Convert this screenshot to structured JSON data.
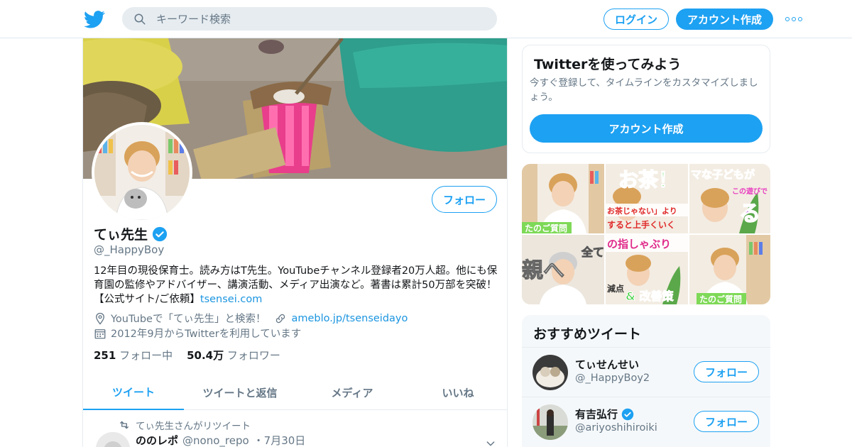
{
  "header": {
    "search_placeholder": "キーワード検索",
    "login_label": "ログイン",
    "signup_label": "アカウント作成"
  },
  "profile": {
    "name": "てぃ先生",
    "handle": "@_HappyBoy",
    "follow_label": "フォロー",
    "bio_text": "12年目の現役保育士。読み方はT先生。YouTubeチャンネル登録者20万人超。他にも保育園の監修やアドバイザー、講演活動、メディア出演など。著書は累計50万部を突破！【公式サイト/ご依頼】",
    "bio_link": "tsensei.com",
    "location": "YouTubeで「てぃ先生」と検索！",
    "website": "ameblo.jp/tsenseidayo",
    "joined": "2012年9月からTwitterを利用しています",
    "following_count": "251",
    "following_label": "フォロー中",
    "followers_count": "50.4万",
    "followers_label": "フォロワー"
  },
  "tabs": [
    {
      "label": "ツイート",
      "active": true
    },
    {
      "label": "ツイートと返信",
      "active": false
    },
    {
      "label": "メディア",
      "active": false
    },
    {
      "label": "いいね",
      "active": false
    }
  ],
  "tweet": {
    "retweet_note": "てぃ先生さんがリツイート",
    "author_name": "ののレポ",
    "author_handle": "@nono_repo",
    "date": "・7月30日"
  },
  "signup_card": {
    "title": "Twitterを使ってみよう",
    "text": "今すぐ登録して、タイムラインをカスタマイズしましょう。",
    "button": "アカウント作成"
  },
  "media_thumbs": [
    {
      "caption": "たのご質問"
    },
    {
      "caption": "お茶！",
      "sub": "お茶じゃない」より",
      "sub2": "すると上手くいく"
    },
    {
      "caption": "マな子どもが",
      "sub": "この遊びで",
      "sub2": "る"
    },
    {
      "caption": "親へ",
      "sub": "全ての"
    },
    {
      "caption": "の指しゃぶり",
      "sub": "減点",
      "sub2": "& 改善策"
    },
    {
      "caption": "たのご質問"
    }
  ],
  "recommendations": {
    "title": "おすすめツイート",
    "items": [
      {
        "name": "てぃせんせい",
        "handle": "@_HappyBoy2",
        "verified": false,
        "follow_label": "フォロー"
      },
      {
        "name": "有吉弘行",
        "handle": "@ariyoshihiroiki",
        "verified": true,
        "follow_label": "フォロー"
      }
    ]
  },
  "colors": {
    "accent": "#1da1f2",
    "link": "#1b95e0",
    "muted": "#657786",
    "text": "#14171a"
  }
}
